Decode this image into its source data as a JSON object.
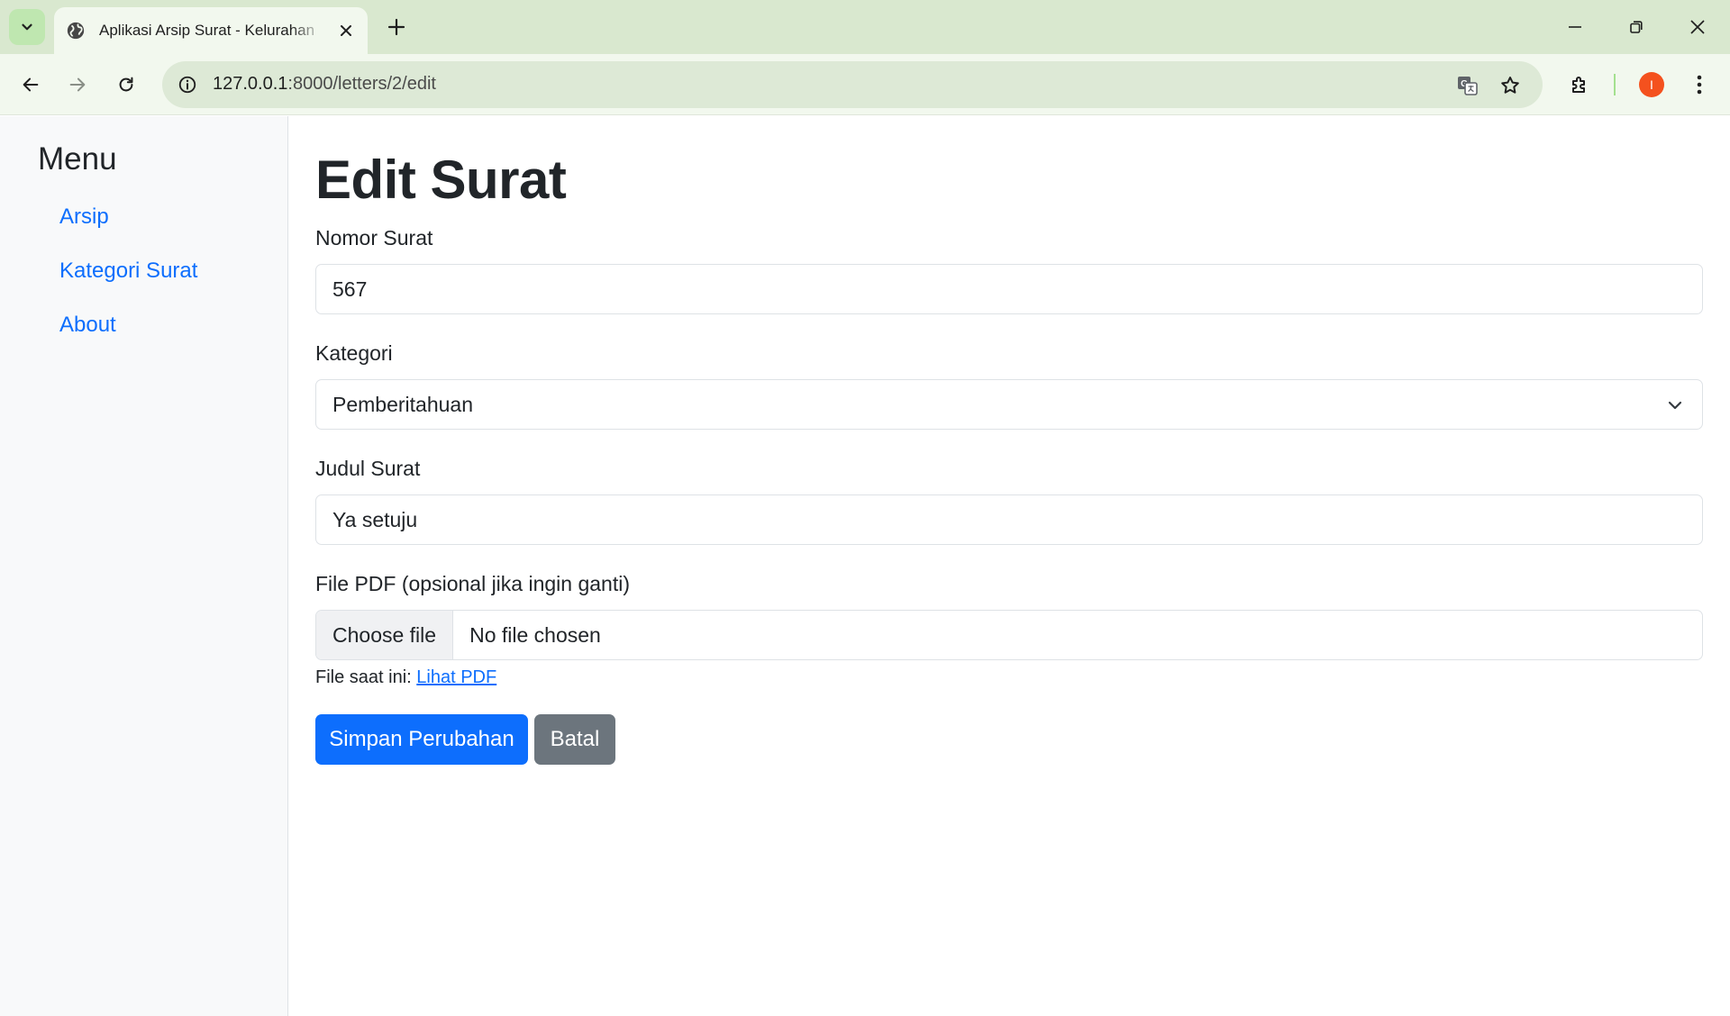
{
  "browser": {
    "tab_title": "Aplikasi Arsip Surat - Kelurahan",
    "url_host": "127.0.0.1",
    "url_rest": ":8000/letters/2/edit",
    "profile_initial": "I"
  },
  "sidebar": {
    "title": "Menu",
    "items": [
      {
        "label": "Arsip"
      },
      {
        "label": "Kategori Surat"
      },
      {
        "label": "About"
      }
    ]
  },
  "form": {
    "title": "Edit Surat",
    "nomor_label": "Nomor Surat",
    "nomor_value": "567",
    "kategori_label": "Kategori",
    "kategori_value": "Pemberitahuan",
    "judul_label": "Judul Surat",
    "judul_value": "Ya setuju",
    "file_label": "File PDF (opsional jika ingin ganti)",
    "file_button": "Choose file",
    "file_status": "No file chosen",
    "current_file_prefix": "File saat ini:",
    "current_file_link": "Lihat PDF",
    "save_button": "Simpan Perubahan",
    "cancel_button": "Batal"
  },
  "colors": {
    "primary": "#0d6efd",
    "secondary": "#6c757d",
    "tabbar": "#d9e8cf",
    "sidebar_bg": "#f8f9fa"
  }
}
